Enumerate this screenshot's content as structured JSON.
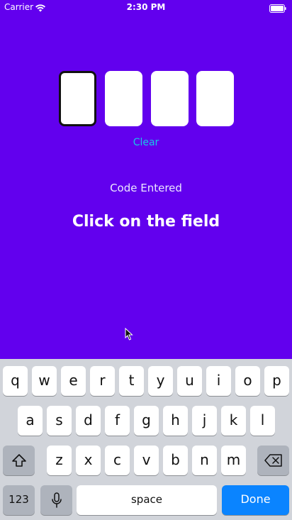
{
  "status_bar": {
    "carrier": "Carrier",
    "time": "2:30 PM",
    "wifi_icon": "wifi-icon",
    "battery_icon": "battery-icon"
  },
  "colors": {
    "background": "#6200EE",
    "accent_link": "#18C7E6",
    "keyboard_bg": "#D1D4DA",
    "done_button": "#0A84FF"
  },
  "code_input": {
    "box_count": 4,
    "active_box_index": 0,
    "values": [
      "",
      "",
      "",
      ""
    ]
  },
  "actions": {
    "clear_label": "Clear"
  },
  "labels": {
    "code_entered": "Code Entered",
    "instruction": "Click on the field"
  },
  "cursor": {
    "icon": "mouse-cursor-icon"
  },
  "keyboard": {
    "row1": [
      "q",
      "w",
      "e",
      "r",
      "t",
      "y",
      "u",
      "i",
      "o",
      "p"
    ],
    "row2": [
      "a",
      "s",
      "d",
      "f",
      "g",
      "h",
      "j",
      "k",
      "l"
    ],
    "row3": [
      "z",
      "x",
      "c",
      "v",
      "b",
      "n",
      "m"
    ],
    "shift_icon": "shift-icon",
    "backspace_icon": "backspace-icon",
    "numbers_label": "123",
    "mic_icon": "microphone-icon",
    "space_label": "space",
    "done_label": "Done"
  }
}
